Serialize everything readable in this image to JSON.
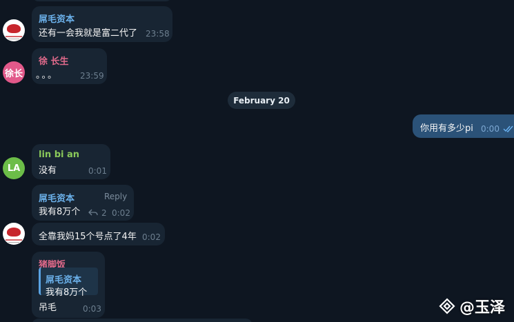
{
  "colors": {
    "background": "#0e1621",
    "bubble_in": "#182533",
    "bubble_out": "#2b5278",
    "name_blue": "#6cb2ec",
    "name_pink": "#e06a8b",
    "name_green": "#8ac95a",
    "time": "#6d7f8f",
    "read_check": "#6ab3f3"
  },
  "date_separator": "February 20",
  "messages": [
    {
      "sender": "屌毛资本",
      "text": "还有一会我就是富二代了",
      "time": "23:58"
    },
    {
      "sender": "徐 长生",
      "avatar_text": "徐长",
      "text": "。。。",
      "time": "23:59"
    },
    {
      "text": "你用有多少pi",
      "time": "0:00",
      "status_icon": "double-check-icon"
    },
    {
      "sender": "lin bi an",
      "avatar_text": "LA",
      "text": "没有",
      "time": "0:01"
    },
    {
      "sender": "屌毛资本",
      "text": "我有8万个",
      "time": "0:02",
      "reply_label": "Reply",
      "reply_count": "2"
    },
    {
      "text": "全靠我妈15个号点了4年",
      "time": "0:02"
    },
    {
      "sender": "猪脚饭",
      "quote_sender": "屌毛资本",
      "quote_text": "我有8万个",
      "text": "吊毛",
      "time": "0:03"
    }
  ],
  "watermark": {
    "text": "@玉泽"
  }
}
